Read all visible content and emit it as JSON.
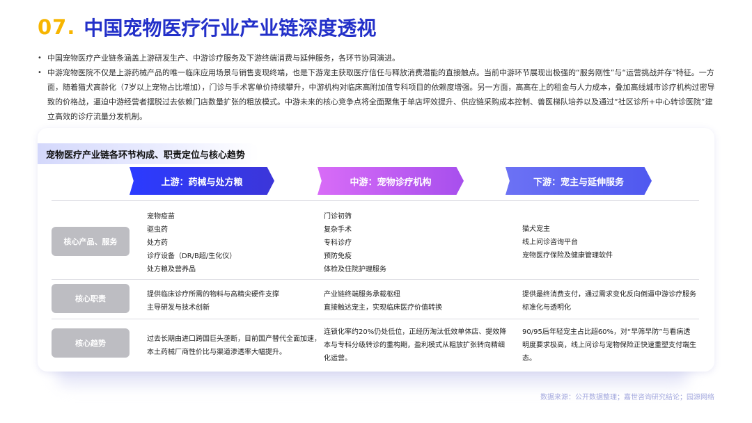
{
  "header": {
    "number": "07.",
    "title": "中国宠物医疗行业产业链深度透视"
  },
  "bullets": [
    "中国宠物医疗产业链条涵盖上游研发生产、中游诊疗服务及下游终端消费与延伸服务，各环节协同演进。",
    "中游宠物医院不仅是上游药械产品的唯一临床应用场景与销售变现终端，也是下游宠主获取医疗信任与释放消费潜能的直接触点。当前中游环节展现出极强的“服务刚性”与“运营挑战并存”特征。一方面，随着猫犬高龄化（7岁以上宠物占比增加），门诊与手术客单价持续攀升，中游机构对临床高附加值专科项目的依赖度增强。另一方面，高高在上的租金与人力成本，叠加高线城市诊疗机构过密导致的价格战，逼迫中游经营者摆脱过去依赖门店数量扩张的粗放模式。中游未来的核心竞争点将全面聚焦于单店坪效提升、供应链采购成本控制、兽医梯队培养以及通过“社区诊所+中心转诊医院”建立高效的诊疗流量分发机制。"
  ],
  "panel": {
    "tag": "宠物医疗产业链各环节构成、职责定位与核心趋势",
    "columns": [
      "上游：药械与处方粮",
      "中游：宠物诊疗机构",
      "下游：宠主与延伸服务"
    ],
    "rows": [
      {
        "label": "核心产品、服务",
        "cells": [
          [
            "宠物疫苗",
            "驱虫药",
            "处方药",
            "诊疗设备（DR/B超/生化仪）",
            "处方粮及营养品"
          ],
          [
            "门诊初筛",
            "复杂手术",
            "专科诊疗",
            "预防免疫",
            "体检及住院护理服务"
          ],
          [
            "猫犬宠主",
            "线上问诊咨询平台",
            "宠物医疗保险及健康管理软件"
          ]
        ]
      },
      {
        "label": "核心职责",
        "cells": [
          [
            "提供临床诊疗所需的物料与高精尖硬件支撑",
            "主导研发与技术创新"
          ],
          [
            "产业链终端服务承载枢纽",
            "直接触达宠主，实现临床医疗价值转换"
          ],
          [
            "提供最终消费支付，通过需求变化反向倒逼中游诊疗服务",
            "标准化与透明化"
          ]
        ]
      },
      {
        "label": "核心趋势",
        "cells": [
          [
            "过去长期由进口跨国巨头垄断，目前国产替代全面加速，",
            "本土药械厂商性价比与渠道渗透率大幅提升。"
          ],
          [
            "连锁化率约20%仍处低位，正经历淘汰低效单体店、提效降",
            "本与专科分级转诊的重构期，盈利模式从粗放扩张转向精细",
            "化运营。"
          ],
          [
            "90/95后年轻宠主占比超60%，对“早筛早防”与看病透",
            "明度要求极高，线上问诊与宠物保险正快速重塑支付端生",
            "态。"
          ]
        ]
      }
    ]
  },
  "source": "数据来源：公开数据整理；嘉世咨询研究结论；园源网络"
}
